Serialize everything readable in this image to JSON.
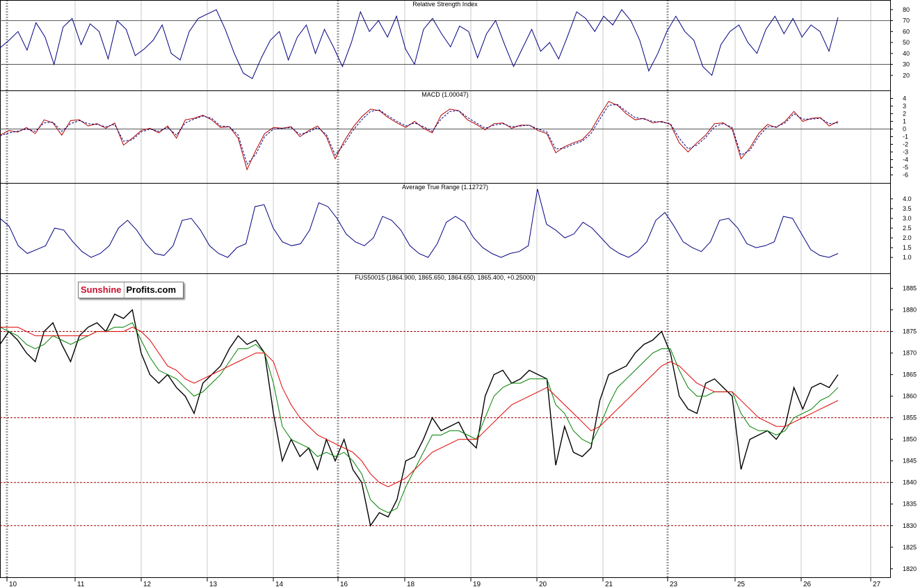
{
  "logo": {
    "part1": "Sunshine",
    "part2": "Profits.com"
  },
  "colors": {
    "rsi": "#000080",
    "macd": "#b00000",
    "signal": "#000080",
    "atr": "#000080",
    "price": "#000000",
    "ma_fast": "#008000",
    "ma_slow": "#e00000",
    "level": "#a00000"
  },
  "chart_data": [
    {
      "type": "line",
      "title": "Relative Strength Index",
      "ylim": [
        10,
        85
      ],
      "yticks": [
        20,
        30,
        40,
        50,
        60,
        70,
        80
      ],
      "reference_lines": [
        30,
        70
      ],
      "series": [
        {
          "values": [
            45,
            52,
            60,
            43,
            68,
            55,
            30,
            64,
            72,
            48,
            67,
            60,
            35,
            70,
            62,
            38,
            44,
            52,
            66,
            40,
            34,
            60,
            72,
            76,
            80,
            62,
            40,
            22,
            17,
            36,
            52,
            60,
            34,
            55,
            66,
            40,
            62,
            46,
            28,
            50,
            78,
            60,
            70,
            55,
            74,
            44,
            30,
            62,
            72,
            58,
            46,
            65,
            60,
            36,
            58,
            70,
            48,
            28,
            45,
            62,
            42,
            50,
            35,
            56,
            78,
            72,
            60,
            74,
            66,
            80,
            70,
            52,
            24,
            40,
            60,
            74,
            60,
            52,
            28,
            20,
            48,
            60,
            66,
            50,
            40,
            62,
            74,
            58,
            72,
            55,
            66,
            60,
            42,
            73
          ]
        }
      ]
    },
    {
      "type": "line",
      "title": "MACD (1.00047)",
      "ylim": [
        -6.5,
        4.5
      ],
      "yticks": [
        4,
        3,
        2,
        1,
        0,
        -1,
        -2,
        -3,
        -4,
        -5,
        -6
      ],
      "reference_lines": [
        0
      ],
      "series": [
        {
          "values": [
            -0.8,
            -0.2,
            -0.4,
            0.2,
            -0.6,
            1.2,
            0.8,
            -0.8,
            1.1,
            1.2,
            0.4,
            0.7,
            0.1,
            0.8,
            -2.1,
            -1.2,
            -0.2,
            0.1,
            -0.5,
            0.4,
            -1.2,
            1.2,
            1.4,
            1.8,
            1.2,
            0.2,
            0.3,
            -1.2,
            -5.3,
            -2.8,
            -0.6,
            0.2,
            0.1,
            0.3,
            -1.0,
            -0.2,
            0.4,
            -1.0,
            -3.9,
            -1.6,
            0.2,
            1.6,
            2.6,
            2.4,
            1.5,
            0.8,
            0.2,
            1.0,
            0.1,
            -0.5,
            1.8,
            2.6,
            2.4,
            1.2,
            0.6,
            -0.1,
            0.7,
            0.8,
            0.1,
            0.5,
            0.5,
            -0.2,
            -0.6,
            -3.1,
            -2.3,
            -1.8,
            -1.4,
            -0.2,
            1.8,
            3.6,
            3.1,
            2.0,
            1.2,
            1.4,
            0.8,
            1.0,
            0.6,
            -1.8,
            -3.0,
            -1.8,
            -0.8,
            0.7,
            0.8,
            0.0,
            -3.9,
            -2.5,
            -0.6,
            0.6,
            0.2,
            1.0,
            2.3,
            1.0,
            1.4,
            1.5,
            0.4,
            1.0
          ]
        },
        {
          "values": [
            -0.9,
            -0.5,
            -0.3,
            0.0,
            -0.3,
            0.8,
            0.9,
            -0.3,
            0.7,
            1.1,
            0.7,
            0.6,
            0.3,
            0.6,
            -1.6,
            -1.4,
            -0.4,
            0.0,
            -0.3,
            0.2,
            -0.8,
            0.8,
            1.3,
            1.7,
            1.4,
            0.4,
            0.3,
            -0.8,
            -4.6,
            -3.3,
            -1.0,
            0.0,
            0.1,
            0.2,
            -0.7,
            -0.4,
            0.2,
            -0.7,
            -3.4,
            -2.0,
            -0.2,
            1.2,
            2.3,
            2.5,
            1.7,
            1.0,
            0.4,
            0.8,
            0.3,
            -0.3,
            1.3,
            2.3,
            2.4,
            1.5,
            0.8,
            0.1,
            0.5,
            0.7,
            0.3,
            0.4,
            0.5,
            0.0,
            -0.4,
            -2.6,
            -2.5,
            -2.0,
            -1.6,
            -0.6,
            1.3,
            3.1,
            3.2,
            2.3,
            1.5,
            1.3,
            1.0,
            0.9,
            0.7,
            -1.2,
            -2.6,
            -2.1,
            -1.1,
            0.3,
            0.7,
            0.2,
            -3.4,
            -2.8,
            -1.0,
            0.3,
            0.3,
            0.8,
            2.0,
            1.3,
            1.3,
            1.4,
            0.7,
            0.8
          ]
        }
      ]
    },
    {
      "type": "line",
      "title": "Average True Range (1.12727)",
      "ylim": [
        0.4,
        4.6
      ],
      "yticks": [
        1.0,
        1.5,
        2.0,
        2.5,
        3.0,
        3.5,
        4.0
      ],
      "series": [
        {
          "values": [
            3.0,
            2.6,
            1.6,
            1.2,
            1.4,
            1.6,
            2.5,
            2.4,
            1.8,
            1.3,
            1.0,
            1.2,
            1.6,
            2.5,
            2.9,
            2.4,
            1.7,
            1.2,
            1.1,
            1.6,
            2.9,
            3.0,
            2.4,
            1.6,
            1.2,
            1.0,
            1.5,
            1.7,
            3.6,
            3.7,
            2.5,
            1.8,
            1.6,
            1.7,
            2.4,
            3.8,
            3.6,
            3.0,
            2.2,
            1.8,
            1.6,
            2.0,
            3.1,
            2.9,
            2.4,
            1.6,
            1.2,
            1.0,
            1.7,
            2.8,
            3.1,
            2.8,
            2.0,
            1.5,
            1.2,
            1.0,
            1.2,
            1.3,
            1.6,
            4.5,
            2.7,
            2.4,
            2.0,
            2.2,
            2.8,
            2.5,
            2.0,
            1.5,
            1.2,
            1.0,
            1.3,
            1.8,
            2.9,
            3.3,
            2.6,
            1.8,
            1.5,
            1.3,
            1.8,
            2.9,
            3.0,
            2.5,
            1.7,
            1.5,
            1.6,
            1.8,
            3.1,
            3.0,
            2.2,
            1.4,
            1.1,
            1.0,
            1.2
          ]
        }
      ]
    },
    {
      "type": "line",
      "title": "FUS50015 (1864.900, 1865.650, 1864.650, 1865.400, +0.25000)",
      "ylim": [
        1819,
        1887.5
      ],
      "yticks": [
        1820,
        1825,
        1830,
        1835,
        1840,
        1845,
        1850,
        1855,
        1860,
        1865,
        1870,
        1875,
        1880,
        1885
      ],
      "reference_lines": [
        1875,
        1855,
        1840,
        1830
      ],
      "x_tick_labels": [
        "10",
        "11",
        "12",
        "13",
        "14",
        "16",
        "18",
        "19",
        "20",
        "21",
        "23",
        "25",
        "26",
        "27"
      ],
      "series": [
        {
          "values": [
            1872,
            1875,
            1873,
            1870,
            1868,
            1875,
            1877,
            1872,
            1868,
            1874,
            1876,
            1877,
            1875,
            1879,
            1878,
            1880,
            1870,
            1865,
            1863,
            1865,
            1862,
            1860,
            1856,
            1863,
            1865,
            1867,
            1871,
            1874,
            1872,
            1873,
            1870,
            1856,
            1845,
            1850,
            1846,
            1848,
            1843,
            1850,
            1845,
            1850,
            1843,
            1840,
            1830,
            1833,
            1832,
            1836,
            1845,
            1846,
            1850,
            1855,
            1852,
            1853,
            1854,
            1850,
            1848,
            1860,
            1865,
            1866,
            1863,
            1864,
            1866,
            1865,
            1864,
            1844,
            1853,
            1847,
            1846,
            1848,
            1859,
            1865,
            1866,
            1867,
            1870,
            1872,
            1873,
            1875,
            1870,
            1860,
            1857,
            1856,
            1863,
            1864,
            1862,
            1860,
            1843,
            1850,
            1851,
            1852,
            1850,
            1853,
            1862,
            1857,
            1862,
            1863,
            1862,
            1865
          ]
        },
        {
          "values": [
            1876,
            1875,
            1874,
            1872,
            1871,
            1872,
            1874,
            1873,
            1872,
            1873,
            1874,
            1875,
            1875,
            1876,
            1876,
            1877,
            1873,
            1869,
            1866,
            1865,
            1864,
            1862,
            1860,
            1861,
            1863,
            1865,
            1868,
            1871,
            1871,
            1872,
            1870,
            1863,
            1853,
            1850,
            1849,
            1848,
            1846,
            1847,
            1846,
            1847,
            1845,
            1842,
            1836,
            1834,
            1833,
            1834,
            1839,
            1843,
            1847,
            1851,
            1851,
            1852,
            1852,
            1851,
            1850,
            1855,
            1860,
            1862,
            1863,
            1863,
            1864,
            1864,
            1864,
            1858,
            1856,
            1852,
            1850,
            1849,
            1853,
            1858,
            1862,
            1864,
            1866,
            1868,
            1870,
            1871,
            1871,
            1866,
            1862,
            1860,
            1860,
            1861,
            1861,
            1861,
            1856,
            1853,
            1852,
            1852,
            1851,
            1852,
            1855,
            1856,
            1857,
            1859,
            1860,
            1862
          ]
        },
        {
          "values": [
            1876,
            1876,
            1876,
            1875,
            1874,
            1874,
            1874,
            1874,
            1874,
            1874,
            1874,
            1875,
            1875,
            1875,
            1875,
            1876,
            1875,
            1873,
            1870,
            1867,
            1866,
            1864,
            1863,
            1864,
            1865,
            1866,
            1867,
            1868,
            1869,
            1870,
            1870,
            1868,
            1862,
            1858,
            1855,
            1853,
            1851,
            1850,
            1849,
            1848,
            1847,
            1845,
            1842,
            1840,
            1839,
            1840,
            1841,
            1843,
            1845,
            1847,
            1848,
            1849,
            1850,
            1850,
            1850,
            1852,
            1854,
            1856,
            1858,
            1859,
            1860,
            1861,
            1862,
            1860,
            1858,
            1856,
            1854,
            1852,
            1853,
            1855,
            1857,
            1859,
            1861,
            1863,
            1865,
            1867,
            1868,
            1867,
            1865,
            1863,
            1862,
            1861,
            1861,
            1861,
            1859,
            1857,
            1855,
            1854,
            1853,
            1853,
            1854,
            1855,
            1856,
            1857,
            1858,
            1859
          ]
        }
      ]
    }
  ]
}
